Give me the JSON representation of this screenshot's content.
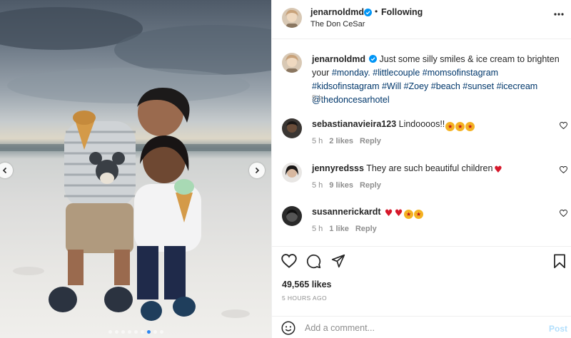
{
  "post": {
    "username": "jenarnoldmd",
    "follow_status": "Following",
    "separator": "•",
    "location": "The Don CeSar",
    "caption": {
      "username": "jenarnoldmd",
      "text_plain": "Just some silly smiles & ice cream to brighten your",
      "tags": [
        "#monday.",
        "#littlecouple",
        "#momsofinstagram",
        "#kidsofinstagram",
        "#Will",
        "#Zoey",
        "#beach",
        "#sunset",
        "#icecream",
        "@thedoncesarhotel"
      ],
      "time": "5 h"
    },
    "comments": [
      {
        "username": "sebastianavieira123",
        "text": "Lindoooos!!",
        "emoji": [
          "star",
          "star",
          "star"
        ],
        "time": "5 h",
        "likes": "2 likes",
        "reply": "Reply"
      },
      {
        "username": "jennyredsss",
        "text": "They are such beautiful children",
        "emoji": [
          "red"
        ],
        "time": "5 h",
        "likes": "9 likes",
        "reply": "Reply"
      },
      {
        "username": "susannerickardt",
        "text": "",
        "emoji": [
          "red",
          "red",
          "star",
          "star"
        ],
        "time": "5 h",
        "likes": "1 like",
        "reply": "Reply"
      }
    ],
    "likes_count": "49,565 likes",
    "posted_ago": "5 HOURS AGO",
    "add_comment": {
      "placeholder": "Add a comment...",
      "post_label": "Post"
    },
    "carousel": {
      "slide_count": 9,
      "active_index": 6
    },
    "icons": {
      "heart": "heart-icon",
      "comment": "comment-icon",
      "share": "share-icon",
      "save": "bookmark-icon",
      "more": "more-options-icon",
      "verified": "verified-badge-icon",
      "smile": "emoji-icon"
    },
    "colors": {
      "link": "#00376b",
      "verified": "#0095f6",
      "muted": "#8e8e8e",
      "post_button": "#b2dffc",
      "carousel_active": "#2b86f0"
    }
  }
}
